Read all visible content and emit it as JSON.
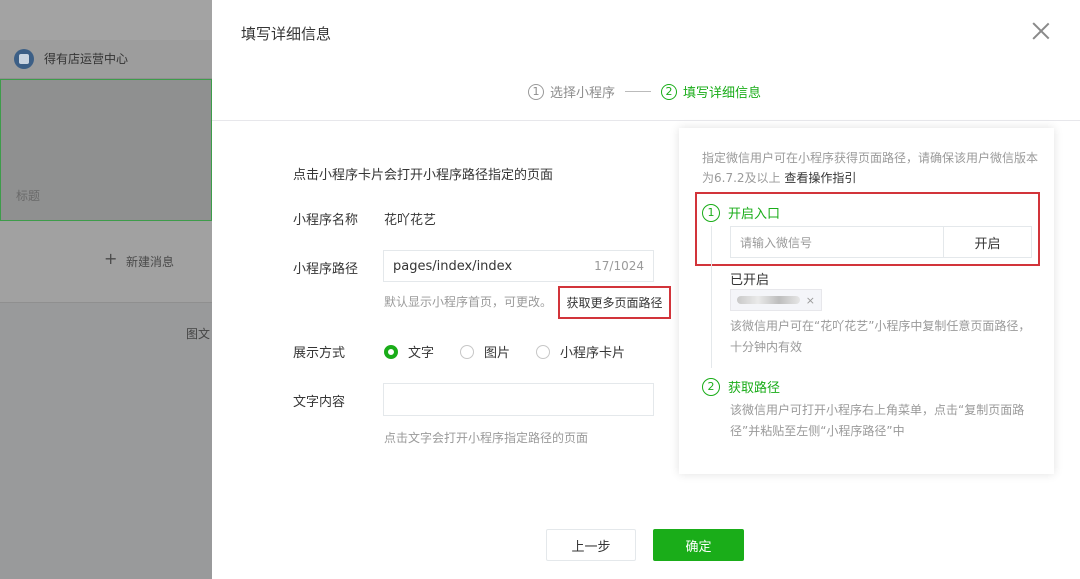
{
  "background": {
    "card_title": "得有店运营中心",
    "preview_label": "标题",
    "new_message": "新建消息",
    "tuwen_label": "图文"
  },
  "dialog": {
    "title": "填写详细信息",
    "steps": [
      {
        "num": "1",
        "label": "选择小程序"
      },
      {
        "num": "2",
        "label": "填写详细信息"
      }
    ],
    "form_desc": "点击小程序卡片会打开小程序路径指定的页面",
    "fields": {
      "name_label": "小程序名称",
      "name_value": "花吖花艺",
      "path_label": "小程序路径",
      "path_value": "pages/index/index",
      "path_count": "17/1024",
      "path_hint": "默认显示小程序首页，可更改。",
      "path_link": "获取更多页面路径",
      "display_label": "展示方式",
      "display_options": [
        "文字",
        "图片",
        "小程序卡片"
      ],
      "display_selected": "文字",
      "content_label": "文字内容",
      "content_value": "",
      "content_hint": "点击文字会打开小程序指定路径的页面"
    },
    "buttons": {
      "prev": "上一步",
      "ok": "确定"
    }
  },
  "popover": {
    "desc": "指定微信用户可在小程序获得页面路径，请确保该用户微信版本为6.7.2及以上",
    "guide_link": "查看操作指引",
    "section1": {
      "num": "1",
      "title": "开启入口"
    },
    "wechat_placeholder": "请输入微信号",
    "open_button": "开启",
    "opened_label": "已开启",
    "opened_tag_partial": "ei",
    "note1": "该微信用户可在“花吖花艺”小程序中复制任意页面路径，十分钟内有效",
    "section2": {
      "num": "2",
      "title": "获取路径"
    },
    "note2": "该微信用户可打开小程序右上角菜单，点击“复制页面路径”并粘贴至左侧“小程序路径”中"
  },
  "colors": {
    "accent_green": "#1aad19",
    "highlight_red": "#d2343a"
  }
}
